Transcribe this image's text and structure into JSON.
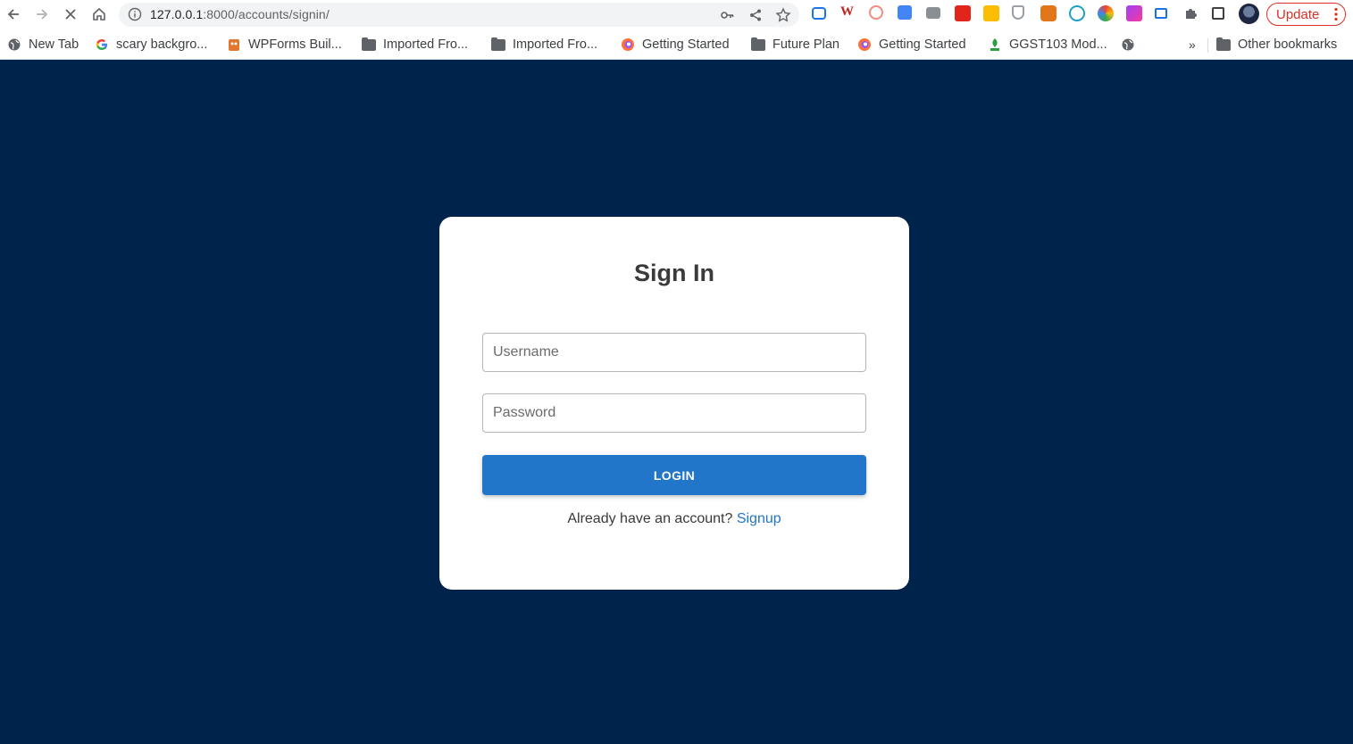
{
  "browser": {
    "url_host": "127.0.0.1",
    "url_rest": ":8000/accounts/signin/",
    "update_label": "Update",
    "icons": {
      "back": "arrow-left-icon",
      "forward": "arrow-right-icon",
      "stop": "close-icon",
      "home": "home-icon",
      "info": "info-icon",
      "key": "key-icon",
      "share": "share-icon",
      "star": "star-icon"
    }
  },
  "bookmarks": {
    "items": [
      {
        "label": "New Tab",
        "icon": "globe-icon"
      },
      {
        "label": "scary backgro...",
        "icon": "google-icon"
      },
      {
        "label": "WPForms Buil...",
        "icon": "wpforms-icon"
      },
      {
        "label": "Imported Fro...",
        "icon": "folder-icon"
      },
      {
        "label": "Imported Fro...",
        "icon": "folder-icon"
      },
      {
        "label": "Getting Started",
        "icon": "firefox-icon"
      },
      {
        "label": "Future Plan",
        "icon": "folder-icon"
      },
      {
        "label": "Getting Started",
        "icon": "firefox-icon"
      },
      {
        "label": "GGST103 Mod...",
        "icon": "leaf-icon"
      }
    ],
    "more_label": "»",
    "other_label": "Other bookmarks"
  },
  "signin": {
    "title": "Sign In",
    "username_placeholder": "Username",
    "password_placeholder": "Password",
    "login_label": "LOGIN",
    "prompt_text": "Already have an account?",
    "signup_label": "Signup"
  },
  "colors": {
    "page_background": "#00234b",
    "accent": "#2276c9",
    "update_red": "#d93025"
  }
}
